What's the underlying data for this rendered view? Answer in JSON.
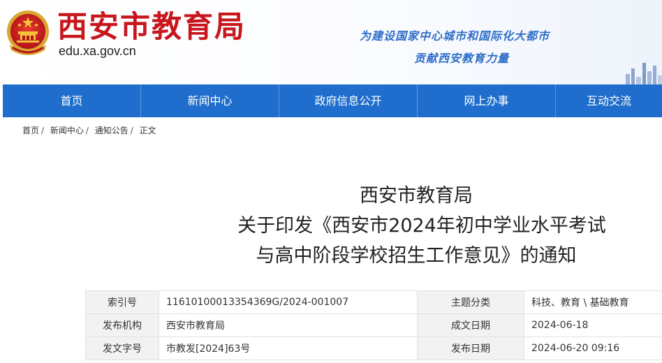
{
  "header": {
    "site_name": "西安市教育局",
    "domain": "edu.xa.gov.cn",
    "slogan_line1": "为建设国家中心城市和国际化大都市",
    "slogan_line2": "贡献西安教育力量",
    "emblem_icon": "national-emblem-icon",
    "brand_color": "#c8161d"
  },
  "nav": {
    "color": "#1f6ecd",
    "items": [
      {
        "label": "首页"
      },
      {
        "label": "新闻中心"
      },
      {
        "label": "政府信息公开"
      },
      {
        "label": "网上办事"
      },
      {
        "label": "互动交流"
      }
    ]
  },
  "breadcrumb": {
    "items": [
      "首页",
      "新闻中心",
      "通知公告",
      "正文"
    ],
    "separator": "/"
  },
  "article": {
    "title_line1": "西安市教育局",
    "title_line2": "关于印发《西安市2024年初中学业水平考试",
    "title_line3": "与高中阶段学校招生工作意见》的通知"
  },
  "info": {
    "rows": [
      {
        "k1": "索引号",
        "v1": "11610100013354369G/2024-001007",
        "k2": "主题分类",
        "v2": "科技、教育 \\ 基础教育"
      },
      {
        "k1": "发布机构",
        "v1": "西安市教育局",
        "k2": "成文日期",
        "v2": "2024-06-18"
      },
      {
        "k1": "发文字号",
        "v1": "市教发[2024]63号",
        "k2": "发布日期",
        "v2": "2024-06-20 09:16"
      }
    ]
  }
}
